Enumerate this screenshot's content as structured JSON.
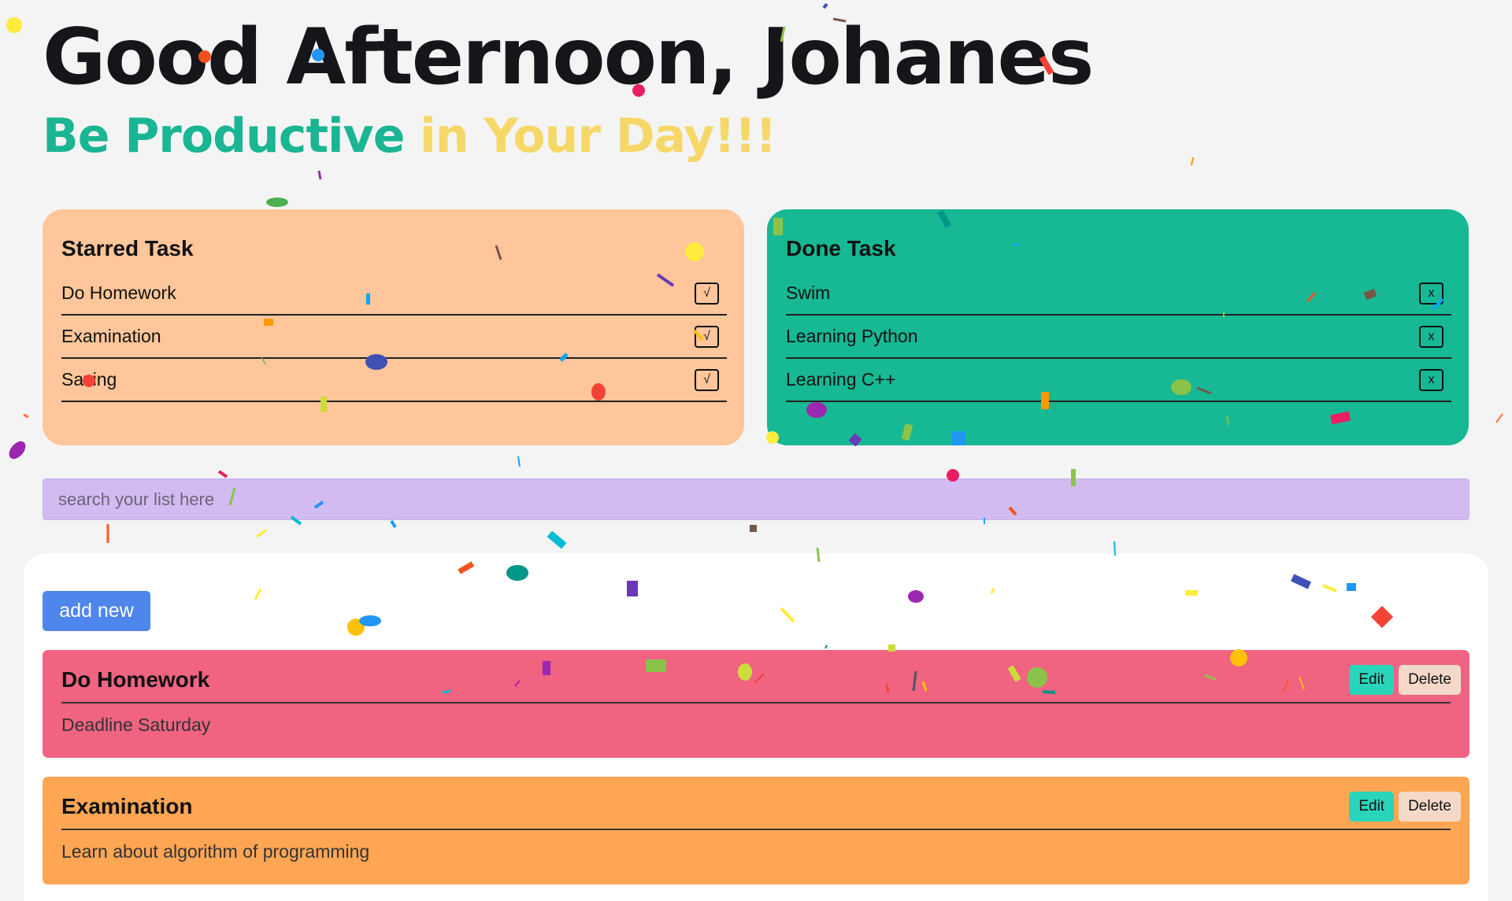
{
  "greeting": "Good Afternoon, Johanes",
  "tagline": {
    "part1": "Be Productive",
    "part2": "in Your Day!!!"
  },
  "starred": {
    "title": "Starred Task",
    "items": [
      {
        "label": "Do Homework",
        "mark": "√"
      },
      {
        "label": "Examination",
        "mark": "√"
      },
      {
        "label": "Saving",
        "mark": "√"
      }
    ]
  },
  "done": {
    "title": "Done Task",
    "items": [
      {
        "label": "Swim",
        "mark": "x"
      },
      {
        "label": "Learning Python",
        "mark": "x"
      },
      {
        "label": "Learning C++",
        "mark": "x"
      }
    ]
  },
  "search": {
    "placeholder": "search your list here"
  },
  "add_button": "add new",
  "tasks": [
    {
      "title": "Do Homework",
      "description": "Deadline Saturday",
      "edit": "Edit",
      "delete": "Delete"
    },
    {
      "title": "Examination",
      "description": "Learn about algorithm of programming",
      "edit": "Edit",
      "delete": "Delete"
    }
  ],
  "colors": {
    "starred_card": "#fec69a",
    "done_card": "#17b894",
    "search_bg": "#d1bbf0",
    "task_pink": "#f06381",
    "task_orange": "#ffa655",
    "add_button": "#4f86ec",
    "edit_button": "#29d5ba"
  }
}
